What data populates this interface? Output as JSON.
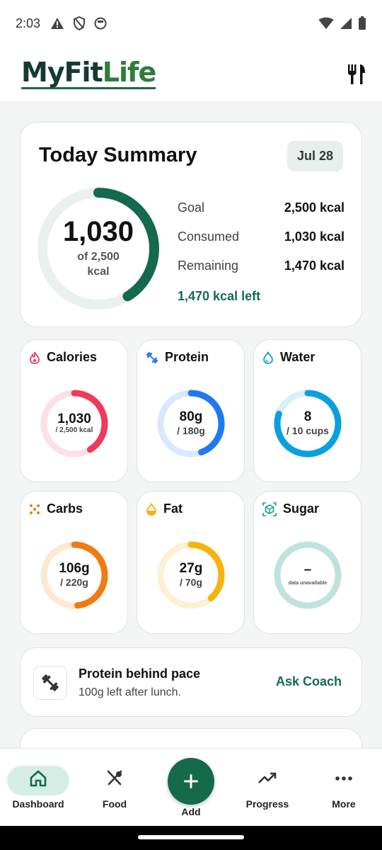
{
  "status_bar": {
    "time": "2:03"
  },
  "app": {
    "logo_part1": "MyFit",
    "logo_part2": "Life"
  },
  "summary": {
    "title": "Today Summary",
    "date": "Jul 28",
    "ring_value": "1,030",
    "ring_of": "of 2,500",
    "ring_unit": "kcal",
    "progress": 0.412,
    "rows": [
      {
        "label": "Goal",
        "value": "2,500 kcal"
      },
      {
        "label": "Consumed",
        "value": "1,030 kcal"
      },
      {
        "label": "Remaining",
        "value": "1,470 kcal"
      }
    ],
    "left_note": "1,470 kcal left"
  },
  "metrics": [
    {
      "name": "calories",
      "title": "Calories",
      "value": "1,030",
      "target": "/ 2,500 kcal",
      "progress": 0.412,
      "color": "#f0395b",
      "track": "#fde0e5",
      "icon": "flame-icon"
    },
    {
      "name": "protein",
      "title": "Protein",
      "value": "80g",
      "target": "/ 180g",
      "progress": 0.444,
      "color": "#2079ef",
      "track": "#dbe8fc",
      "icon": "dumbbell-icon"
    },
    {
      "name": "water",
      "title": "Water",
      "value": "8",
      "target": "/ 10 cups",
      "progress": 0.8,
      "color": "#0aa0df",
      "track": "#d8f0fa",
      "icon": "droplet-icon"
    },
    {
      "name": "carbs",
      "title": "Carbs",
      "value": "106g",
      "target": "/ 220g",
      "progress": 0.482,
      "color": "#f07b12",
      "track": "#fde8d4",
      "icon": "grain-icon"
    },
    {
      "name": "fat",
      "title": "Fat",
      "value": "27g",
      "target": "/ 70g",
      "progress": 0.386,
      "color": "#f6b20e",
      "track": "#fdf0d3",
      "icon": "oil-drop-icon"
    },
    {
      "name": "sugar",
      "title": "Sugar",
      "value": "–",
      "target": "data unavailable",
      "progress": 0,
      "color": "#bfe3dc",
      "track": "#bfe3dc",
      "icon": "cube-icon"
    }
  ],
  "coach": {
    "title": "Protein behind pace",
    "subtitle": "100g left after lunch.",
    "action": "Ask Coach"
  },
  "nav": {
    "dashboard": "Dashboard",
    "food": "Food",
    "add": "Add",
    "progress": "Progress",
    "more": "More"
  },
  "colors": {
    "accent": "#146a4b",
    "ring_track": "#e9f0ed",
    "active_pill": "#d6ede5"
  }
}
